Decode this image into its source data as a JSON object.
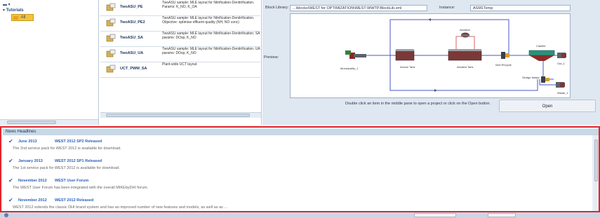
{
  "tree": {
    "items": [
      {
        "label": "Tutorials",
        "selected": false
      },
      {
        "label": "All",
        "selected": true
      }
    ]
  },
  "projects": [
    {
      "name": "TwoASU_PE",
      "desc": "TwoASU sample: MLE layout for Nitrification-Denitrification. Params: K_NO, K_OA"
    },
    {
      "name": "TwoASU_PE2",
      "desc": "TwoASU sample: MLE layout for Nitrification-Denitrification. Objective: optimise effluent quality (NH, NO conc)"
    },
    {
      "name": "TwoASU_SA",
      "desc": "TwoASU sample: MLE layout for Nitrification-Denitrification. SA params: DOsp, K_NO"
    },
    {
      "name": "TwoASU_UA",
      "desc": "TwoASU sample: MLE layout for Nitrification-Denitrification. UA params: DOsp, K_NO"
    },
    {
      "name": "UCT_PWM_SA",
      "desc": "Plant-wide UCT layout"
    }
  ],
  "right_panel": {
    "block_library_label": "Block Library:",
    "block_library_value": "...\\blocks\\WEST for OPTIMIZATION\\WEST-WWTP.BlockLib.xml",
    "instance_label": "Instance:",
    "instance_value": "ASM1Temp",
    "preview_label": "Preview:",
    "hint": "Double click an item in the middle pane to open a project or click on the Open button.",
    "open_button": "Open"
  },
  "diagram": {
    "nodes": [
      "Municipality_1",
      "Anoxic Tank",
      "Aerated Tank",
      "Aeration",
      "Clarifier",
      "Inlet Recycle",
      "Out_1",
      "Sludge Waste",
      "Waste_1"
    ]
  },
  "news": {
    "header": "News Headlines",
    "items": [
      {
        "date": "June 2013",
        "title": "WEST 2012 SP2 Released",
        "desc": "The 2nd service pack for WEST 2012 is available for download."
      },
      {
        "date": "January 2013",
        "title": "WEST 2012 SP1 Released",
        "desc": "The 1st service pack for WEST 2012 is available for download."
      },
      {
        "date": "November 2012",
        "title": "WEST User Forum",
        "desc": "The WEST User Forum has been integrated with the overall MIKEbyDHI forum."
      },
      {
        "date": "November 2012",
        "title": "WEST 2012 Released",
        "desc": "WEST 2012 extends the classic DHI brand system and has an improved number of new features and models, as well as as ..."
      }
    ]
  },
  "colors": {
    "accent": "#2b61b8",
    "highlight": "#e0262c",
    "selection": "#f3c23e"
  }
}
